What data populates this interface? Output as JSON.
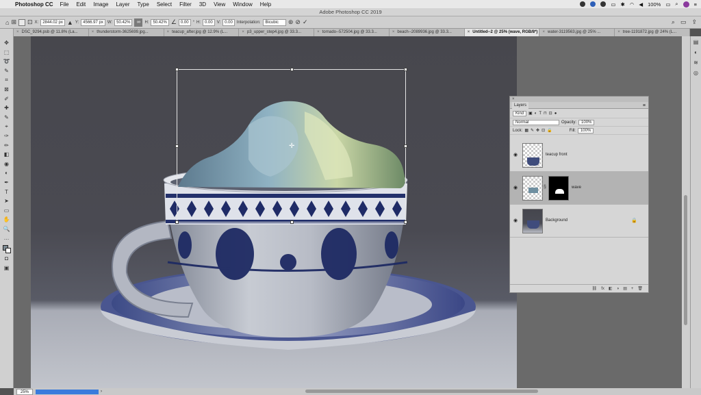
{
  "menubar": {
    "app": "Photoshop CC",
    "items": [
      "File",
      "Edit",
      "Image",
      "Layer",
      "Type",
      "Select",
      "Filter",
      "3D",
      "View",
      "Window",
      "Help"
    ],
    "battery": "100%"
  },
  "window": {
    "title": "Adobe Photoshop CC 2019"
  },
  "options": {
    "x_label": "X:",
    "x_value": "2844.02 px",
    "y_label": "Y:",
    "y_value": "4566.97 px",
    "w_label": "W:",
    "w_value": "50.42%",
    "h_label": "H:",
    "h_value": "50.42%",
    "angle_value": "0.00",
    "angle_unit": "°",
    "h2_label": "H:",
    "h2_value": "0.00",
    "v_label": "V:",
    "v_value": "0.00",
    "interp_label": "Interpolation:",
    "interp_value": "Bicubic",
    "commit_icon": "✓",
    "cancel_icon": "⊘"
  },
  "tabs": [
    "DSC_9294.psb @ 11.8% (La...",
    "thunderstorm-3625699.jpg...",
    "teacup_after.jpg @ 12.9% (L...",
    "p3_upper_step4.jpg @ 33.3...",
    "tornado--572504.jpg @ 33.3...",
    "beach--2089936.jpg @ 33.3...",
    "Untitled--2 @ 25% (wave, RGB/8*) *",
    "water-3119563.jpg @ 25% ...",
    "tree-1191872.jpg @ 24% (L..."
  ],
  "active_tab_index": 6,
  "tools": [
    "✥",
    "⬚",
    "➰",
    "✎",
    "⌗",
    "⊠",
    "✐",
    "✚",
    "✎",
    "⌖",
    "✑",
    "✏",
    "◧",
    "◉",
    "◐",
    "✒",
    "T",
    "➤",
    "▭",
    "✋",
    "🔍",
    "…"
  ],
  "layers_panel": {
    "title": "Layers",
    "filter_placeholder": "Kind",
    "blend_mode": "Normal",
    "opacity_label": "Opacity:",
    "opacity_value": "100%",
    "lock_label": "Lock:",
    "fill_label": "Fill:",
    "fill_value": "100%",
    "layers": [
      {
        "name": "teacup front",
        "selected": false
      },
      {
        "name": "wave",
        "selected": true
      },
      {
        "name": "Background",
        "selected": false
      }
    ],
    "footer_icons": [
      "⛓",
      "fx",
      "◧",
      "◑",
      "▤",
      "+",
      "🗑"
    ]
  },
  "status": {
    "zoom": "25%"
  }
}
